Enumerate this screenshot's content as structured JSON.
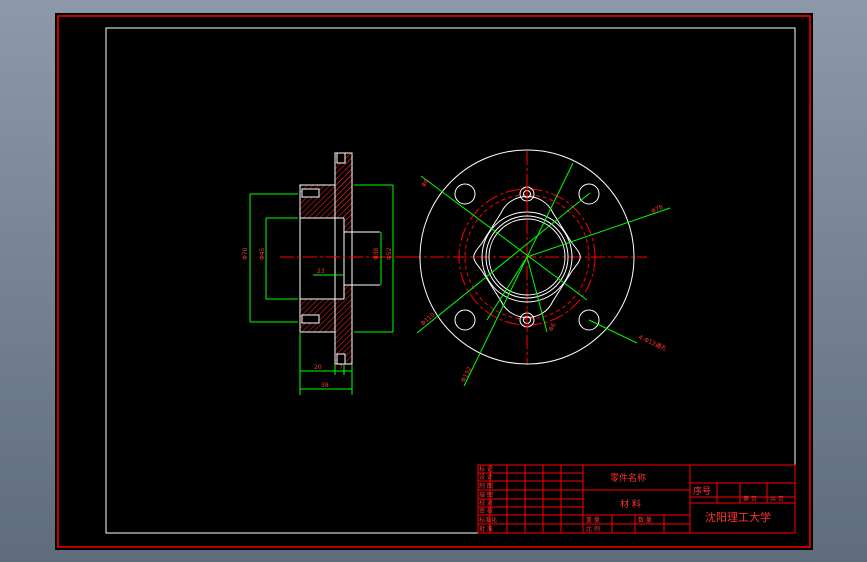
{
  "title_block": {
    "part_name": "零件名称",
    "material": "材  料",
    "seq_no": "序号",
    "university": "沈阳理工大学",
    "left_rows": [
      "标 记",
      "设 计",
      "制 图",
      "描 图",
      "校 对",
      "审 核",
      "标准化",
      "批 准"
    ],
    "weight_label": "重 量",
    "scale_label": "比 例",
    "count_label": "数 量",
    "sheet_label": "第 页",
    "total_label": "共 页"
  },
  "dimensions": {
    "d_outer_left": "Φ70",
    "d_bore": "Φ45",
    "d_inner": "Φ38",
    "d_right": "Φ52",
    "step": "23",
    "width_mid": "20",
    "width_flange": "7",
    "width_total": "38",
    "circle_a": "Φ8",
    "circle_b": "Φ78",
    "circle_c": "Φ6",
    "circle_d": "Φ110",
    "circle_e": "Φ132",
    "holes_note": "4-Φ12通孔"
  },
  "colors": {
    "page_bg": "#000000",
    "border": "#ff0000",
    "outline": "#ffffff",
    "center_line": "#ff0000",
    "dimension": "#00ff00",
    "hatch": "#ff0000"
  }
}
